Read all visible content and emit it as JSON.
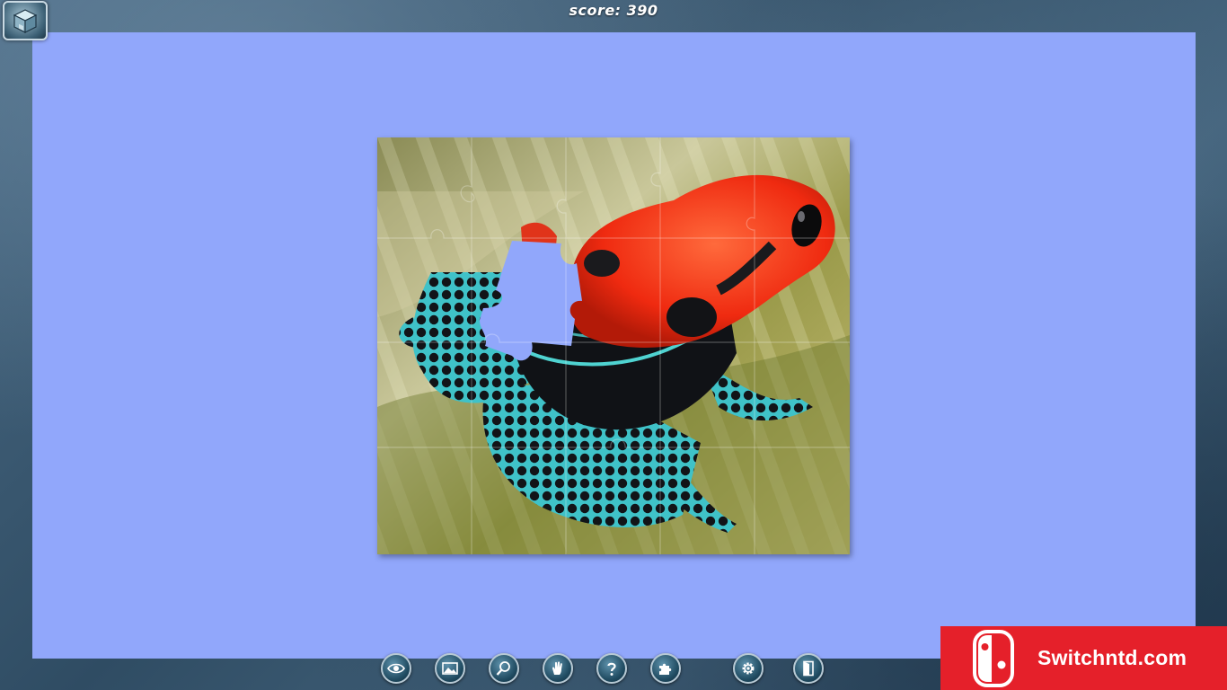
{
  "hud": {
    "score_text": "score: 390"
  },
  "puzzle": {
    "subject": "red-headed poison dart frog on a leaf",
    "state": "in progress, one piece missing"
  },
  "toolbar": {
    "buttons": [
      {
        "name": "eye-button",
        "icon": "eye-icon"
      },
      {
        "name": "preview-image-button",
        "icon": "picture-icon"
      },
      {
        "name": "magnify-button",
        "icon": "magnifier-icon"
      },
      {
        "name": "hint-hand-button",
        "icon": "hand-icon"
      },
      {
        "name": "help-button",
        "icon": "question-icon"
      },
      {
        "name": "pieces-button",
        "icon": "puzzle-piece-icon"
      },
      {
        "name": "settings-button",
        "icon": "gear-icon"
      },
      {
        "name": "exit-button",
        "icon": "exit-door-icon"
      }
    ]
  },
  "watermark": {
    "text": "Switchntd.com",
    "color": "#e5202a"
  },
  "colors": {
    "board": "#91a7fb",
    "frame": "#35536b"
  }
}
